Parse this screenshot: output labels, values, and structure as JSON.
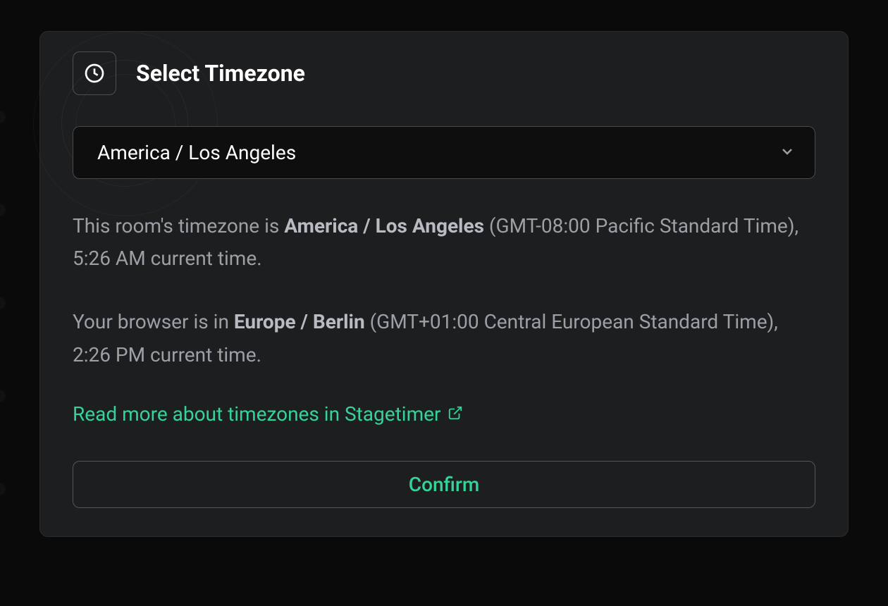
{
  "dialog": {
    "title": "Select Timezone",
    "icon": "clock-icon"
  },
  "select": {
    "value": "America / Los Angeles"
  },
  "info": {
    "room": {
      "prefix": "This room's timezone is ",
      "tz_name": "America / Los Angeles",
      "detail": " (GMT-08:00 Pacific Standard Time), 5:26 AM current time."
    },
    "browser": {
      "prefix": "Your browser is in ",
      "tz_name": "Europe / Berlin",
      "detail": " (GMT+01:00 Central European Standard Time), 2:26 PM current time."
    }
  },
  "link": {
    "label": "Read more about timezones in Stagetimer"
  },
  "actions": {
    "confirm_label": "Confirm"
  },
  "colors": {
    "accent": "#34d399",
    "bg": "#0a0a0a",
    "panel": "#1d1e20",
    "text_muted": "#9aa0a6"
  }
}
